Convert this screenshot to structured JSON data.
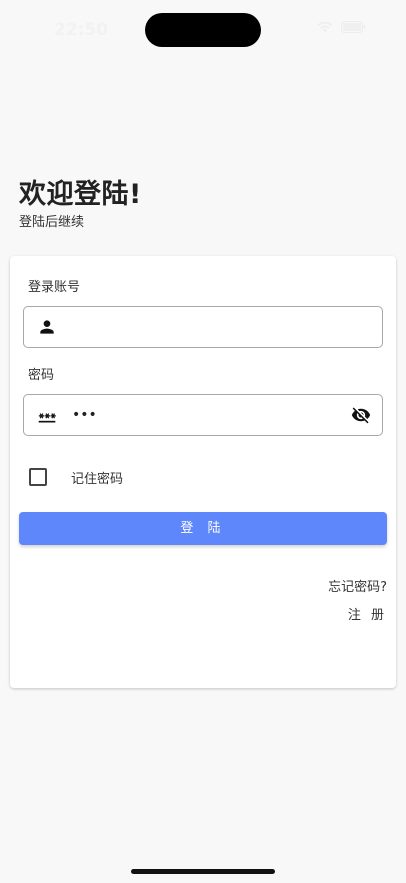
{
  "status_bar": {
    "time": "22:50"
  },
  "welcome": {
    "title": "欢迎登陆!",
    "subtitle": "登陆后继续"
  },
  "form": {
    "account_label": "登录账号",
    "account_value": "",
    "account_icon": "person-icon",
    "password_label": "密码",
    "password_value": "***",
    "password_icon": "password-icon",
    "visibility_icon": "eye-off-icon",
    "remember_label": "记住密码",
    "remember_checked": false,
    "login_label": "登 陆",
    "forgot_label": "忘记密码?",
    "register_label": "注 册"
  },
  "colors": {
    "primary": "#5e87fc",
    "background": "#f8f8f8",
    "card": "#ffffff"
  }
}
